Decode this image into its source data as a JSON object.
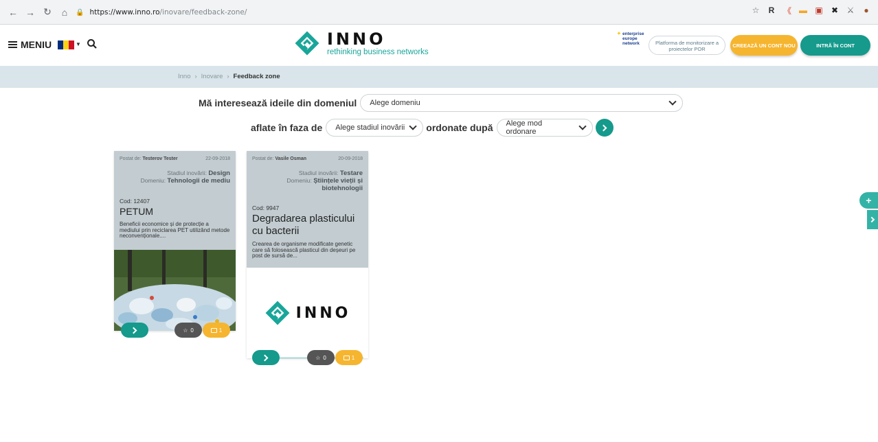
{
  "browser": {
    "url_host": "https://www.inno.ro",
    "url_path": "/inovare/feedback-zone/",
    "extensions": [
      "☆",
      "R",
      "《",
      "▬",
      "▣",
      "✖",
      "⚔",
      "●"
    ]
  },
  "header": {
    "menu_label": "MENIU",
    "logo_name": "INNO",
    "logo_tagline": "rethinking business networks",
    "een_label": "enterprise europe network",
    "platform_btn": "Platforma de monitorizare a proiectelor POR",
    "register_btn": "CREEAZĂ UN CONT NOU",
    "login_btn": "INTRĂ ÎN CONT"
  },
  "breadcrumb": {
    "items": [
      "Inno",
      "Inovare",
      "Feedback zone"
    ],
    "separator": "›"
  },
  "filters": {
    "domain_label": "Mă interesează ideile din domeniul",
    "domain_value": "Alege domeniu",
    "phase_label": "aflate în faza de",
    "phase_value": "Alege stadiul inovării",
    "order_label": "ordonate după",
    "order_value": "Alege mod ordonare"
  },
  "cards": [
    {
      "posted_prefix": "Postat de:",
      "author": "Testerov Tester",
      "date": "22-09-2018",
      "stage_prefix": "Stadiul inovării:",
      "stage": "Design",
      "domain_prefix": "Domeniu:",
      "domain": "Tehnologii de mediu",
      "code": "Cod: 12407",
      "title": "PETUM",
      "description": "Beneficii economice și de protecție a mediului prin reciclarea PET utilizând metode neconvenționale....",
      "stars": "0",
      "comments": "1"
    },
    {
      "posted_prefix": "Postat de:",
      "author": "Vasile Osman",
      "date": "20-09-2018",
      "stage_prefix": "Stadiul inovării:",
      "stage": "Testare",
      "domain_prefix": "Domeniu:",
      "domain": "Științele vieții și biotehnologii",
      "code": "Cod: 9947",
      "title": "Degradarea plasticului cu bacterii",
      "description": "Crearea de organisme modificate genetic care să folosească plasticul din deșeuri pe post de sursă de...",
      "logo_text": "INNO",
      "stars": "0",
      "comments": "1"
    }
  ],
  "side": {
    "plus": "+"
  },
  "colors": {
    "teal": "#159a8c",
    "orange": "#f6b52f",
    "card_head": "#c2ccd1",
    "crumb_bg": "#d9e5ea"
  }
}
